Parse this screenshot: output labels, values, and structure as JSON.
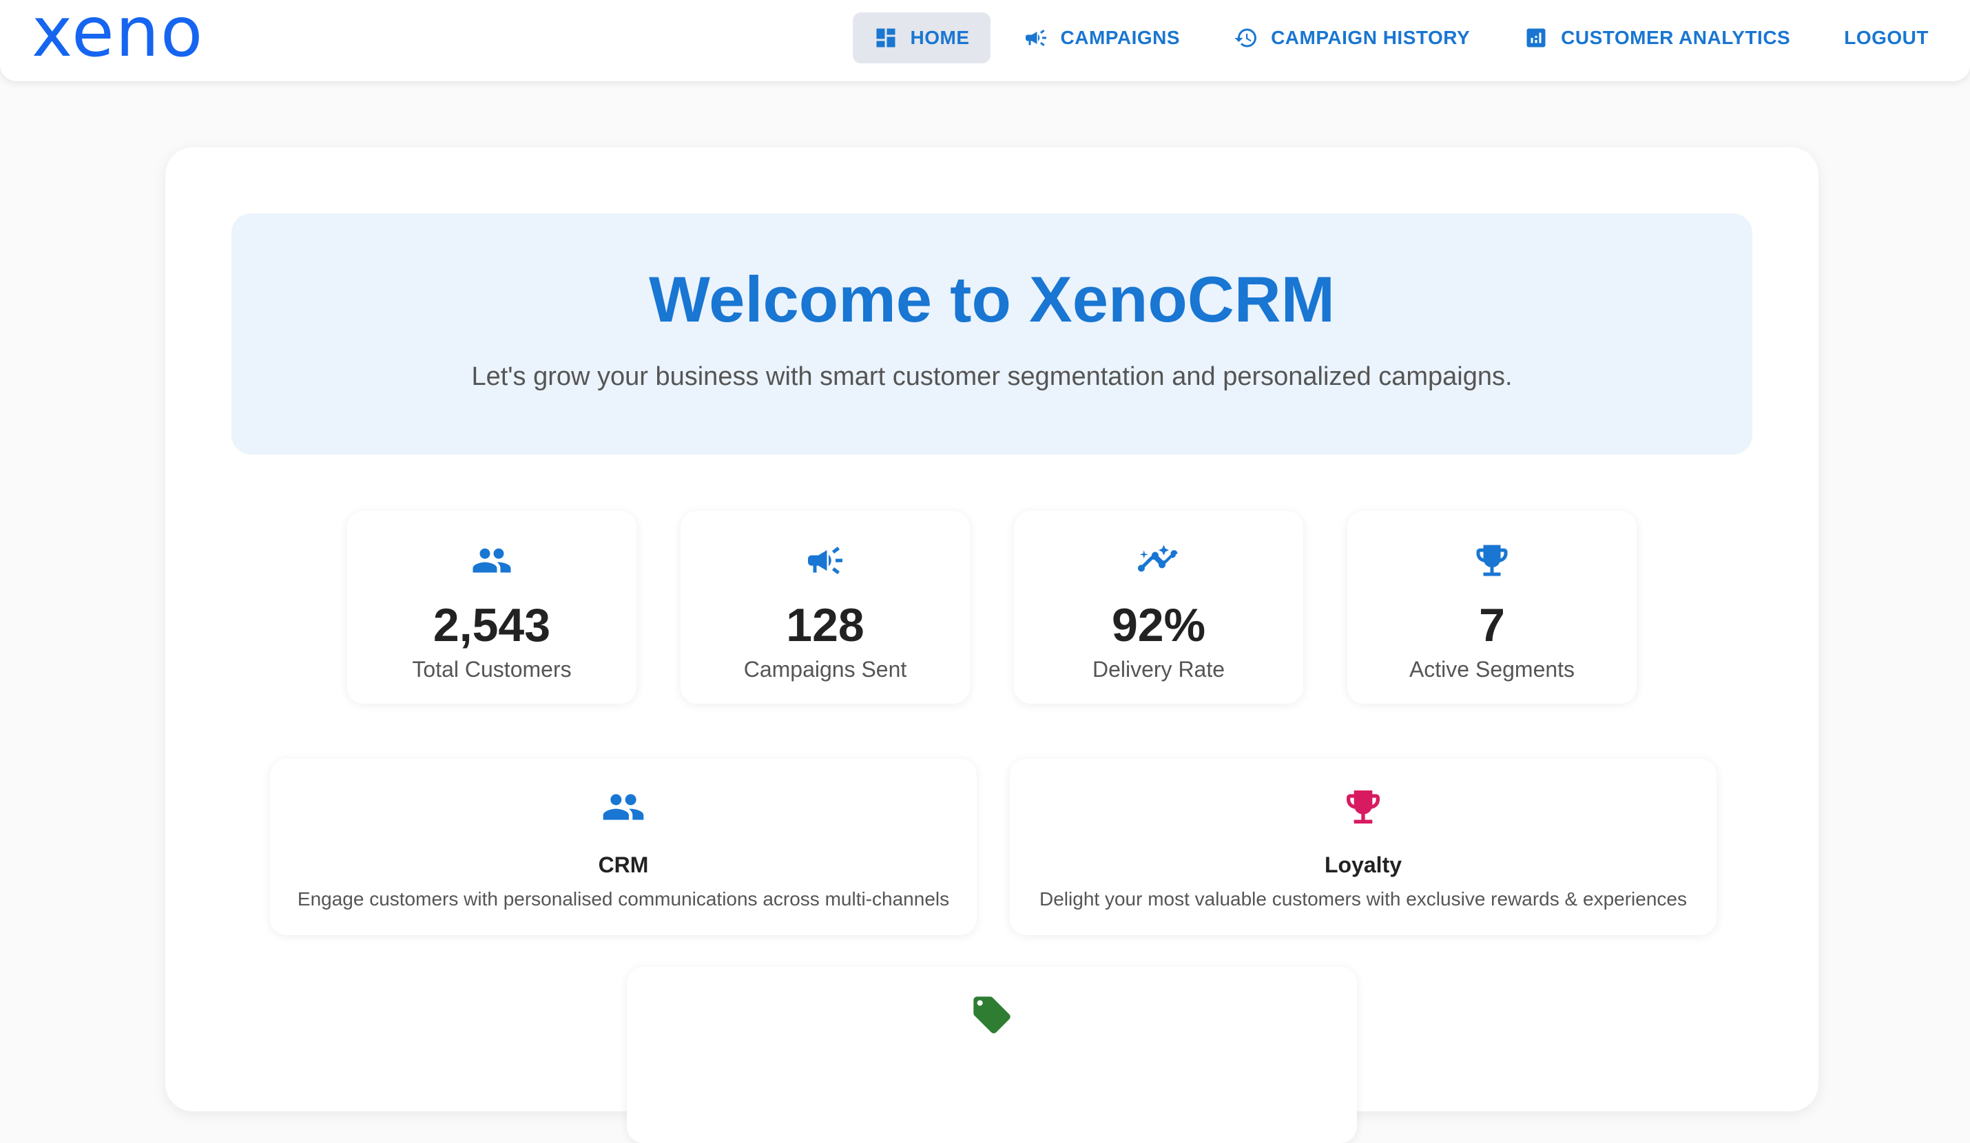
{
  "brand": {
    "logo_text": "xeno",
    "color": "#1565f0"
  },
  "nav": {
    "items": [
      {
        "label": "HOME",
        "icon": "dashboard-icon",
        "active": true
      },
      {
        "label": "CAMPAIGNS",
        "icon": "campaign-icon"
      },
      {
        "label": "CAMPAIGN HISTORY",
        "icon": "history-icon"
      },
      {
        "label": "CUSTOMER ANALYTICS",
        "icon": "analytics-icon"
      },
      {
        "label": "LOGOUT"
      }
    ]
  },
  "hero": {
    "title": "Welcome to XenoCRM",
    "subtitle": "Let's grow your business with smart customer segmentation and personalized campaigns."
  },
  "stats": [
    {
      "value": "2,543",
      "label": "Total Customers",
      "icon": "people-icon"
    },
    {
      "value": "128",
      "label": "Campaigns Sent",
      "icon": "campaign-icon"
    },
    {
      "value": "92%",
      "label": "Delivery Rate",
      "icon": "trending-icon"
    },
    {
      "value": "7",
      "label": "Active Segments",
      "icon": "trophy-icon"
    }
  ],
  "features": [
    {
      "title": "CRM",
      "description": "Engage customers with personalised communications across multi-channels",
      "icon": "people-icon",
      "color": "#1976d2"
    },
    {
      "title": "Loyalty",
      "description": "Delight your most valuable customers with exclusive rewards & experiences",
      "icon": "trophy-icon",
      "color": "#d81b60"
    },
    {
      "icon": "tag-icon",
      "color": "#2e7d32"
    }
  ],
  "colors": {
    "accent": "#1976d2",
    "hero_bg": "#ebf3fc"
  }
}
